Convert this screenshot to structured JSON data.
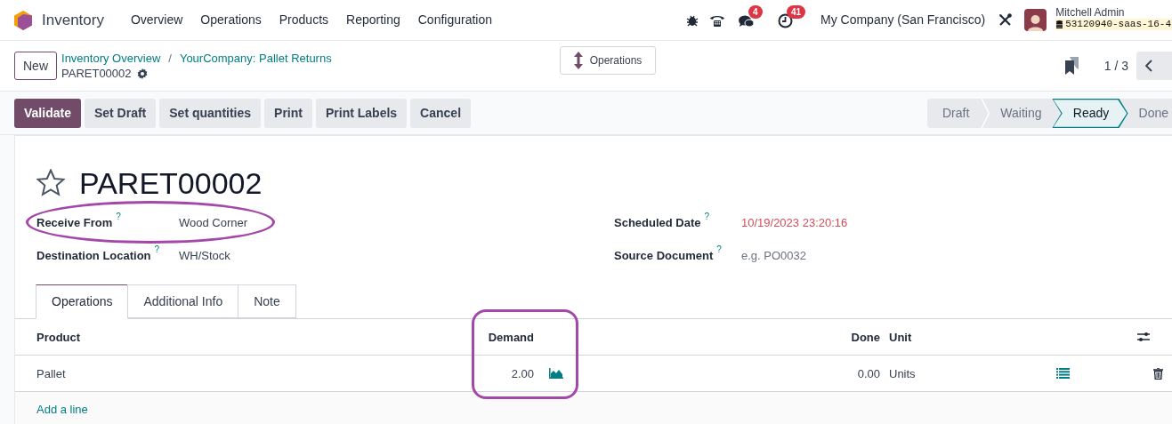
{
  "navbar": {
    "app_name": "Inventory",
    "menu": [
      "Overview",
      "Operations",
      "Products",
      "Reporting",
      "Configuration"
    ],
    "messages_badge": "4",
    "activities_badge": "41",
    "company": "My Company (San Francisco)",
    "user_name": "Mitchell Admin",
    "database": "53120940-saas-16-4"
  },
  "control_panel": {
    "new_button": "New",
    "breadcrumbs": [
      "Inventory Overview",
      "YourCompany: Pallet Returns"
    ],
    "separator": "/",
    "record": "PARET00002",
    "operations_button": "Operations",
    "pager": "1 / 3"
  },
  "actions": [
    {
      "label": "Validate",
      "kind": "primary"
    },
    {
      "label": "Set Draft",
      "kind": "secondary"
    },
    {
      "label": "Set quantities",
      "kind": "secondary"
    },
    {
      "label": "Print",
      "kind": "secondary"
    },
    {
      "label": "Print Labels",
      "kind": "secondary"
    },
    {
      "label": "Cancel",
      "kind": "secondary"
    }
  ],
  "status_bar": [
    {
      "label": "Draft",
      "selected": false
    },
    {
      "label": "Waiting",
      "selected": false
    },
    {
      "label": "Ready",
      "selected": true
    },
    {
      "label": "Done",
      "selected": false
    }
  ],
  "form": {
    "title": "PARET00002",
    "starred": false,
    "left_fields": [
      {
        "label": "Receive From",
        "help": "?",
        "value": "Wood Corner",
        "overdue": false,
        "highlighted": true
      },
      {
        "label": "Destination Location",
        "help": "?",
        "value": "WH/Stock",
        "overdue": false,
        "highlighted": false
      }
    ],
    "right_fields": [
      {
        "label": "Scheduled Date",
        "help": "?",
        "value": "10/19/2023 23:20:16",
        "overdue": true,
        "highlighted": false
      },
      {
        "label": "Source Document",
        "help": "?",
        "placeholder": "e.g. PO0032",
        "overdue": false,
        "highlighted": false
      }
    ]
  },
  "tabs": [
    {
      "label": "Operations",
      "selected": true
    },
    {
      "label": "Additional Info",
      "selected": false
    },
    {
      "label": "Note",
      "selected": false
    }
  ],
  "table": {
    "columns": [
      "Product",
      "Demand",
      "Done",
      "Unit"
    ],
    "demand_highlighted": true,
    "rows": [
      {
        "product": "Pallet",
        "demand": "2.00",
        "done": "0.00",
        "unit": "Units"
      }
    ],
    "add_line": "Add a line"
  }
}
